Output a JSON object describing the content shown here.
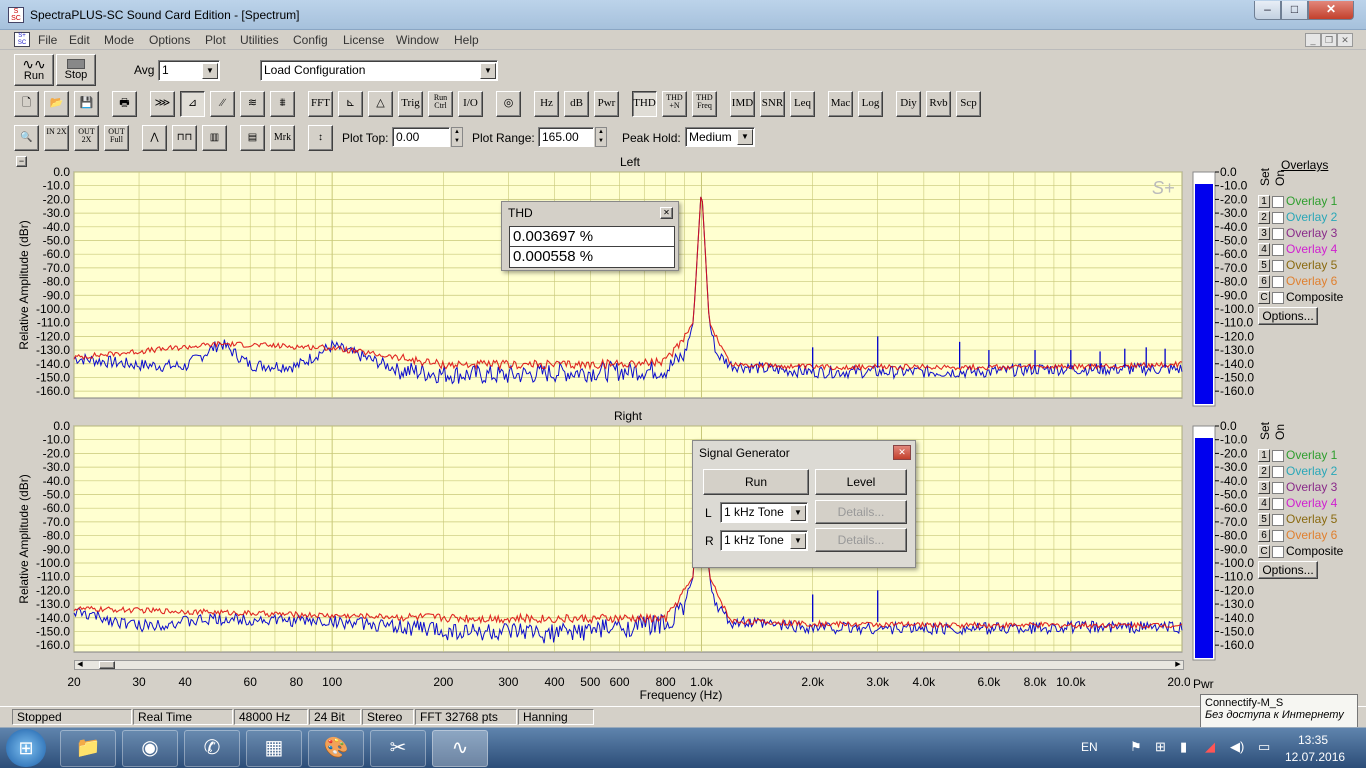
{
  "window": {
    "title": "SpectraPLUS-SC Sound Card Edition - [Spectrum]"
  },
  "menu": [
    "File",
    "Edit",
    "Mode",
    "Options",
    "Plot",
    "Utilities",
    "Config",
    "License",
    "Window",
    "Help"
  ],
  "controls": {
    "run_label": "Run",
    "stop_label": "Stop",
    "avg_label": "Avg",
    "avg_value": "1",
    "load_config": "Load Configuration"
  },
  "toolbar1": [
    "FFT",
    "Trig",
    "Run Ctrl",
    "I/O",
    "Hz",
    "dB",
    "Pwr",
    "THD",
    "THD +N",
    "THD Freq",
    "IMD",
    "SNR",
    "Leq",
    "Mac",
    "Log",
    "Diy",
    "Rvb",
    "Scp"
  ],
  "toolbar2": {
    "zin": "IN 2X",
    "zout": "OUT 2X",
    "zfull": "OUT Full",
    "mrk": "Mrk",
    "plot_top_label": "Plot Top:",
    "plot_top_value": "0.00",
    "plot_range_label": "Plot Range:",
    "plot_range_value": "165.00",
    "peak_hold_label": "Peak Hold:",
    "peak_hold_value": "Medium"
  },
  "plots": {
    "left_title": "Left",
    "right_title": "Right",
    "ylabel": "Relative Amplitude (dBr)",
    "xlabel": "Frequency (Hz)",
    "bar_label": "Pwr",
    "watermark": "S+"
  },
  "y_ticks": [
    "0.0",
    "-10.0",
    "-20.0",
    "-30.0",
    "-40.0",
    "-50.0",
    "-60.0",
    "-70.0",
    "-80.0",
    "-90.0",
    "-100.0",
    "-110.0",
    "-120.0",
    "-130.0",
    "-140.0",
    "-150.0",
    "-160.0"
  ],
  "x_ticks": [
    {
      "v": 20,
      "l": "20"
    },
    {
      "v": 30,
      "l": "30"
    },
    {
      "v": 40,
      "l": "40"
    },
    {
      "v": 60,
      "l": "60"
    },
    {
      "v": 80,
      "l": "80"
    },
    {
      "v": 100,
      "l": "100"
    },
    {
      "v": 200,
      "l": "200"
    },
    {
      "v": 300,
      "l": "300"
    },
    {
      "v": 400,
      "l": "400"
    },
    {
      "v": 500,
      "l": "500"
    },
    {
      "v": 600,
      "l": "600"
    },
    {
      "v": 800,
      "l": "800"
    },
    {
      "v": 1000,
      "l": "1.0k"
    },
    {
      "v": 2000,
      "l": "2.0k"
    },
    {
      "v": 3000,
      "l": "3.0k"
    },
    {
      "v": 4000,
      "l": "4.0k"
    },
    {
      "v": 6000,
      "l": "6.0k"
    },
    {
      "v": 8000,
      "l": "8.0k"
    },
    {
      "v": 10000,
      "l": "10.0k"
    },
    {
      "v": 20000,
      "l": "20.0k"
    }
  ],
  "overlays": {
    "title": "Overlays",
    "set_label": "Set",
    "on_label": "On",
    "items": [
      {
        "num": "1",
        "label": "Overlay 1",
        "color": "#2f9e2f"
      },
      {
        "num": "2",
        "label": "Overlay 2",
        "color": "#2aa7b8"
      },
      {
        "num": "3",
        "label": "Overlay 3",
        "color": "#8a2b8a"
      },
      {
        "num": "4",
        "label": "Overlay 4",
        "color": "#d020d0"
      },
      {
        "num": "5",
        "label": "Overlay 5",
        "color": "#8a6a10"
      },
      {
        "num": "6",
        "label": "Overlay 6",
        "color": "#e08030"
      },
      {
        "num": "C",
        "label": "Composite",
        "color": "#000000"
      }
    ],
    "options_label": "Options..."
  },
  "thd": {
    "title": "THD",
    "values": [
      "0.003697 %",
      "0.000558 %"
    ]
  },
  "siggen": {
    "title": "Signal Generator",
    "run": "Run",
    "level": "Level",
    "l_label": "L",
    "r_label": "R",
    "l_value": "1 kHz Tone",
    "r_value": "1 kHz Tone",
    "details": "Details..."
  },
  "status": [
    "Stopped",
    "Real Time",
    "48000 Hz",
    "24 Bit",
    "Stereo",
    "FFT 32768 pts",
    "Hanning"
  ],
  "network": {
    "name": "Connectify-M_S",
    "status": "Без доступа к Интернету"
  },
  "tray": {
    "lang": "EN",
    "time": "13:35",
    "date": "12.07.2016"
  },
  "colors": {
    "plot_bg": "#ffffd0",
    "grid": "#c8c878",
    "channel_blue": "#0000cc",
    "overlay_red": "#dd1111",
    "meter": "#0000ee"
  },
  "chart_data": [
    {
      "type": "line",
      "title": "Left",
      "xlabel": "Frequency (Hz)",
      "ylabel": "Relative Amplitude (dBr)",
      "xscale": "log",
      "xlim": [
        20,
        20000
      ],
      "ylim": [
        -165,
        0
      ],
      "series": [
        {
          "color": "#0000cc",
          "x": [
            20,
            30,
            40,
            50,
            60,
            80,
            100,
            150,
            200,
            300,
            400,
            600,
            800,
            900,
            950,
            1000,
            1050,
            1100,
            1200,
            1500,
            2000,
            3000,
            4000,
            5000,
            6000,
            8000,
            10000,
            15000,
            20000
          ],
          "y": [
            -135,
            -140,
            -141,
            -124,
            -140,
            -141,
            -126,
            -143,
            -146,
            -147,
            -145,
            -144,
            -143,
            -132,
            -110,
            -10,
            -110,
            -132,
            -140,
            -143,
            -145,
            -145,
            -145,
            -145,
            -145,
            -143,
            -143,
            -143,
            -143
          ]
        },
        {
          "color": "#dd1111",
          "x": [
            20,
            50,
            100,
            200,
            500,
            800,
            950,
            1000,
            1050,
            1200,
            2000,
            5000,
            10000,
            20000
          ],
          "y": [
            -135,
            -125,
            -128,
            -140,
            -140,
            -138,
            -110,
            -10,
            -110,
            -140,
            -142,
            -142,
            -142,
            -140
          ]
        }
      ],
      "peaks": [
        {
          "x": 2000,
          "y": -128
        },
        {
          "x": 3000,
          "y": -120
        },
        {
          "x": 5000,
          "y": -124
        },
        {
          "x": 6000,
          "y": -130
        },
        {
          "x": 8000,
          "y": -130
        },
        {
          "x": 10000,
          "y": -130
        },
        {
          "x": 12000,
          "y": -131
        },
        {
          "x": 14000,
          "y": -129
        },
        {
          "x": 16000,
          "y": -128
        },
        {
          "x": 18000,
          "y": -129
        }
      ]
    },
    {
      "type": "line",
      "title": "Right",
      "xlabel": "Frequency (Hz)",
      "ylabel": "Relative Amplitude (dBr)",
      "xscale": "log",
      "xlim": [
        20,
        20000
      ],
      "ylim": [
        -165,
        0
      ],
      "series": [
        {
          "color": "#0000cc",
          "x": [
            20,
            30,
            50,
            100,
            200,
            300,
            400,
            600,
            800,
            900,
            950,
            1000,
            1050,
            1100,
            1200,
            1500,
            2000,
            3000,
            5000,
            10000,
            20000
          ],
          "y": [
            -135,
            -145,
            -140,
            -142,
            -148,
            -150,
            -150,
            -146,
            -143,
            -130,
            -110,
            -10,
            -110,
            -132,
            -142,
            -144,
            -146,
            -147,
            -147,
            -146,
            -146
          ]
        },
        {
          "color": "#dd1111",
          "x": [
            20,
            40,
            100,
            300,
            800,
            950,
            1000,
            1050,
            1200,
            2000,
            5000,
            20000
          ],
          "y": [
            -133,
            -135,
            -138,
            -140,
            -140,
            -110,
            -10,
            -110,
            -142,
            -144,
            -145,
            -145
          ]
        }
      ],
      "peaks": [
        {
          "x": 2000,
          "y": -123
        },
        {
          "x": 3000,
          "y": -120
        }
      ]
    }
  ]
}
